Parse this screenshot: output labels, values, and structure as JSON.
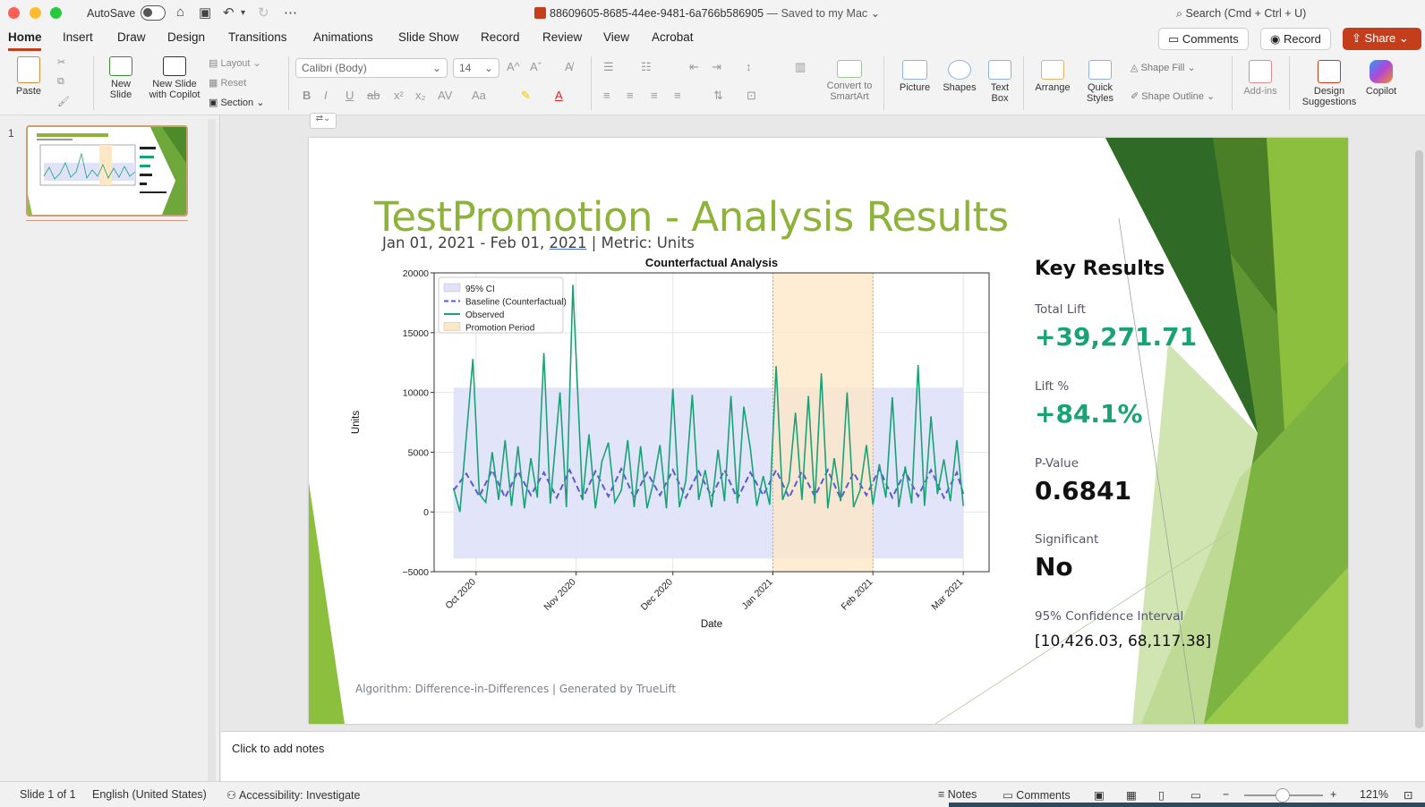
{
  "titlebar": {
    "autosave_label": "AutoSave",
    "doc_name": "88609605-8685-44ee-9481-6a766b586905",
    "save_status": "— Saved to my Mac",
    "search_placeholder": "Search (Cmd + Ctrl + U)"
  },
  "tabs": [
    "Home",
    "Insert",
    "Draw",
    "Design",
    "Transitions",
    "Animations",
    "Slide Show",
    "Record",
    "Review",
    "View",
    "Acrobat"
  ],
  "header_buttons": {
    "comments": "Comments",
    "record": "Record",
    "share": "Share"
  },
  "ribbon": {
    "paste": "Paste",
    "new_slide": "New\nSlide",
    "new_slide_copilot": "New Slide\nwith Copilot",
    "layout": "Layout",
    "reset": "Reset",
    "section": "Section",
    "font_name": "Calibri (Body)",
    "font_size": "14",
    "convert_smartart": "Convert to\nSmartArt",
    "picture": "Picture",
    "shapes": "Shapes",
    "text_box": "Text\nBox",
    "arrange": "Arrange",
    "quick_styles": "Quick\nStyles",
    "shape_fill": "Shape Fill",
    "shape_outline": "Shape Outline",
    "add_ins": "Add-ins",
    "design_suggestions": "Design\nSuggestions",
    "copilot": "Copilot"
  },
  "thumbnails": [
    {
      "number": "1"
    }
  ],
  "slide": {
    "title": "TestPromotion - Analysis Results",
    "subtitle_pre": "Jan 01, 2021 - Feb 01, ",
    "subtitle_year": "2021",
    "subtitle_post": " | Metric: Units",
    "footer": "Algorithm: Difference-in-Differences | Generated by TrueLift",
    "key_results": {
      "heading": "Key Results",
      "total_lift_label": "Total Lift",
      "total_lift_value": "+39,271.71",
      "lift_pct_label": "Lift %",
      "lift_pct_value": "+84.1%",
      "pvalue_label": "P-Value",
      "pvalue_value": "0.6841",
      "significant_label": "Significant",
      "significant_value": "No",
      "ci_label": "95% Confidence Interval",
      "ci_value": "[10,426.03, 68,117.38]"
    }
  },
  "chart_data": {
    "type": "line",
    "title": "Counterfactual Analysis",
    "xlabel": "Date",
    "ylabel": "Units",
    "ylim": [
      -5000,
      20000
    ],
    "yticks": [
      "20000",
      "15000",
      "10000",
      "5000",
      "0",
      "−5000"
    ],
    "ytick_values": [
      20000,
      15000,
      10000,
      5000,
      0,
      -5000
    ],
    "xticks": [
      "Oct 2020",
      "Nov 2020",
      "Dec 2020",
      "Jan 2021",
      "Feb 2021",
      "Mar 2021"
    ],
    "xtick_dates": [
      "2020-10-01",
      "2020-11-01",
      "2020-12-01",
      "2021-01-01",
      "2021-02-01",
      "2021-03-01"
    ],
    "xlim": [
      "2020-09-18",
      "2021-03-09"
    ],
    "grid": true,
    "legend_position": "top-left",
    "legend": [
      "95% CI",
      "Baseline (Counterfactual)",
      "Observed",
      "Promotion Period"
    ],
    "ci_band": {
      "name": "95% CI",
      "x_start": "2020-09-24",
      "x_end": "2021-03-01",
      "lower": -3900,
      "upper": 10400
    },
    "promotion_period": {
      "name": "Promotion Period",
      "start": "2021-01-01",
      "end": "2021-02-01"
    },
    "series": [
      {
        "name": "Observed",
        "x": [
          "2020-09-24",
          "2020-09-26",
          "2020-09-30",
          "2020-10-02",
          "2020-10-04",
          "2020-10-06",
          "2020-10-08",
          "2020-10-10",
          "2020-10-12",
          "2020-10-14",
          "2020-10-16",
          "2020-10-18",
          "2020-10-20",
          "2020-10-22",
          "2020-10-24",
          "2020-10-27",
          "2020-10-29",
          "2020-10-31",
          "2020-11-03",
          "2020-11-05",
          "2020-11-07",
          "2020-11-09",
          "2020-11-11",
          "2020-11-13",
          "2020-11-15",
          "2020-11-17",
          "2020-11-19",
          "2020-11-21",
          "2020-11-23",
          "2020-11-25",
          "2020-11-27",
          "2020-11-29",
          "2020-12-01",
          "2020-12-03",
          "2020-12-05",
          "2020-12-07",
          "2020-12-09",
          "2020-12-11",
          "2020-12-13",
          "2020-12-15",
          "2020-12-17",
          "2020-12-19",
          "2020-12-21",
          "2020-12-23",
          "2020-12-25",
          "2020-12-27",
          "2020-12-29",
          "2020-12-31",
          "2021-01-02",
          "2021-01-04",
          "2021-01-06",
          "2021-01-08",
          "2021-01-10",
          "2021-01-12",
          "2021-01-14",
          "2021-01-16",
          "2021-01-18",
          "2021-01-20",
          "2021-01-22",
          "2021-01-24",
          "2021-01-26",
          "2021-01-28",
          "2021-01-30",
          "2021-02-01",
          "2021-02-03",
          "2021-02-05",
          "2021-02-07",
          "2021-02-09",
          "2021-02-11",
          "2021-02-13",
          "2021-02-15",
          "2021-02-17",
          "2021-02-19",
          "2021-02-21",
          "2021-02-23",
          "2021-02-25",
          "2021-02-27",
          "2021-03-01"
        ],
        "values": [
          2000,
          0,
          12800,
          1500,
          800,
          5000,
          1000,
          6000,
          500,
          5500,
          300,
          4500,
          1200,
          13300,
          700,
          10000,
          400,
          19000,
          1000,
          6500,
          300,
          4200,
          5800,
          800,
          1800,
          6000,
          400,
          5500,
          300,
          2500,
          5600,
          300,
          10300,
          400,
          2600,
          9800,
          1000,
          3500,
          400,
          5200,
          900,
          9700,
          700,
          8800,
          5300,
          500,
          3000,
          600,
          12200,
          1000,
          2500,
          8300,
          1000,
          9700,
          700,
          11600,
          300,
          4500,
          900,
          10000,
          400,
          1800,
          5600,
          600,
          4000,
          1200,
          9600,
          400,
          3800,
          700,
          12300,
          500,
          8000,
          1500,
          4400,
          900,
          6000,
          500
        ]
      },
      {
        "name": "Baseline (Counterfactual)",
        "x": [
          "2020-09-24",
          "2020-09-28",
          "2020-10-02",
          "2020-10-06",
          "2020-10-10",
          "2020-10-14",
          "2020-10-18",
          "2020-10-22",
          "2020-10-26",
          "2020-10-30",
          "2020-11-03",
          "2020-11-07",
          "2020-11-11",
          "2020-11-15",
          "2020-11-19",
          "2020-11-23",
          "2020-11-27",
          "2020-12-01",
          "2020-12-05",
          "2020-12-09",
          "2020-12-13",
          "2020-12-17",
          "2020-12-21",
          "2020-12-25",
          "2020-12-29",
          "2021-01-02",
          "2021-01-06",
          "2021-01-10",
          "2021-01-14",
          "2021-01-18",
          "2021-01-22",
          "2021-01-26",
          "2021-01-30",
          "2021-02-03",
          "2021-02-07",
          "2021-02-11",
          "2021-02-15",
          "2021-02-19",
          "2021-02-23",
          "2021-02-27",
          "2021-03-01"
        ],
        "values": [
          1800,
          3200,
          1300,
          3500,
          1200,
          3400,
          1400,
          3300,
          1200,
          3500,
          1100,
          3400,
          1300,
          3600,
          1200,
          3300,
          1400,
          3500,
          1200,
          3400,
          1300,
          3500,
          1100,
          3300,
          1400,
          3500,
          1200,
          3400,
          1300,
          3500,
          1100,
          3300,
          1400,
          3600,
          1200,
          3400,
          1300,
          3500,
          1200,
          3300,
          1500
        ]
      }
    ]
  },
  "notes_placeholder": "Click to add notes",
  "statusbar": {
    "slide_info": "Slide 1 of 1",
    "language": "English (United States)",
    "accessibility": "Accessibility: Investigate",
    "notes": "Notes",
    "comments": "Comments",
    "zoom": "121%"
  },
  "colors": {
    "brand": "#c43e1c",
    "title_green": "#8db339",
    "kpi_green": "#1aa277",
    "observed": "#1aa277",
    "baseline": "#5a5ad6",
    "ci": "#dfe2f8",
    "promo": "#fde7c4"
  }
}
